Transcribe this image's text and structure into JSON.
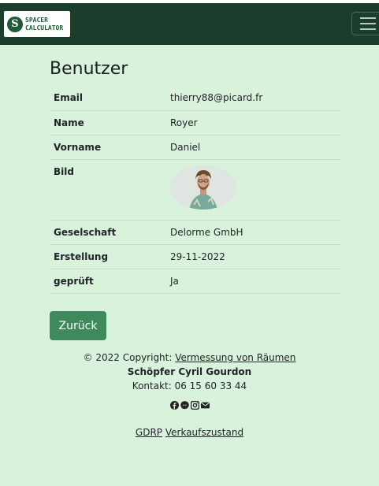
{
  "navbar": {
    "brand_initial": "S",
    "brand_line1": "SPACER",
    "brand_line2": "CALCULATOR"
  },
  "page_title": "Benutzer",
  "details": [
    {
      "label": "Email",
      "value": "thierry88@picard.fr"
    },
    {
      "label": "Name",
      "value": "Royer"
    },
    {
      "label": "Vorname",
      "value": "Daniel"
    },
    {
      "label": "Bild",
      "value": ""
    },
    {
      "label": "Geselschaft",
      "value": "Delorme GmbH"
    },
    {
      "label": "Erstellung",
      "value": "29-11-2022"
    },
    {
      "label": "geprüft",
      "value": "Ja"
    }
  ],
  "back_button": "Zurück",
  "footer": {
    "copyright_prefix": "© 2022 Copyright: ",
    "copyright_link": "Vermessung von Räumen",
    "creator": "Schöpfer Cyril Gourdon",
    "contact": "Kontakt: 06 15 60 33 44",
    "social_icons": [
      "facebook-icon",
      "messenger-icon",
      "instagram-icon",
      "envelope-icon"
    ],
    "gdrp_link": "GDRP",
    "sales_link": "Verkaufszustand"
  }
}
